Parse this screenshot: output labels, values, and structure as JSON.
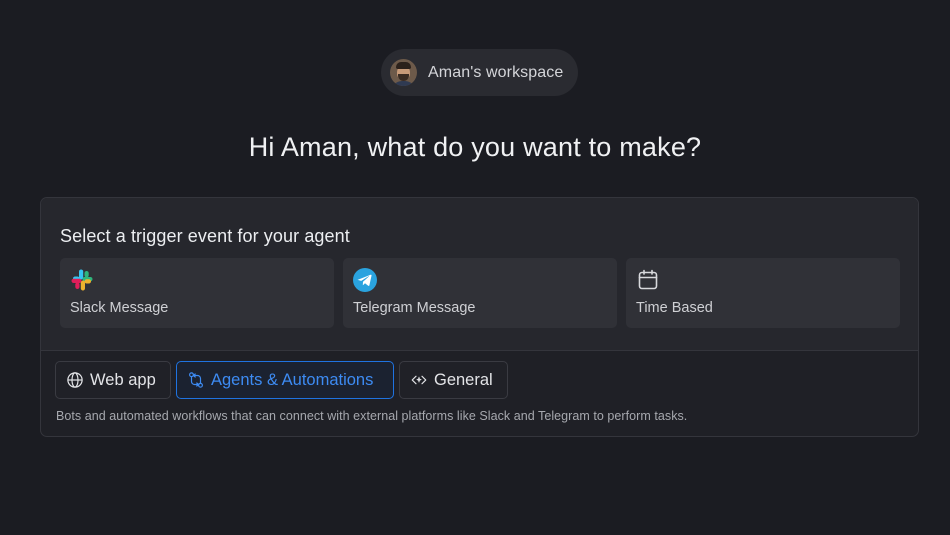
{
  "workspace": {
    "name": "Aman's workspace"
  },
  "heading": "Hi Aman, what do you want to make?",
  "trigger_section": {
    "title": "Select a trigger event for your agent",
    "cards": [
      {
        "label": "Slack Message",
        "icon": "slack-icon"
      },
      {
        "label": "Telegram Message",
        "icon": "telegram-icon"
      },
      {
        "label": "Time Based",
        "icon": "calendar-icon"
      }
    ]
  },
  "tabs": [
    {
      "label": "Web app",
      "icon": "globe-icon",
      "active": false
    },
    {
      "label": "Agents & Automations",
      "icon": "workflow-icon",
      "active": true
    },
    {
      "label": "General",
      "icon": "code-sparkle-icon",
      "active": false
    }
  ],
  "description": "Bots and automated workflows that can connect with external platforms like Slack and Telegram to perform tasks.",
  "colors": {
    "background": "#1b1c22",
    "accent": "#3d8bf2",
    "accent_border": "#1f73e0",
    "telegram": "#2aa3df"
  }
}
